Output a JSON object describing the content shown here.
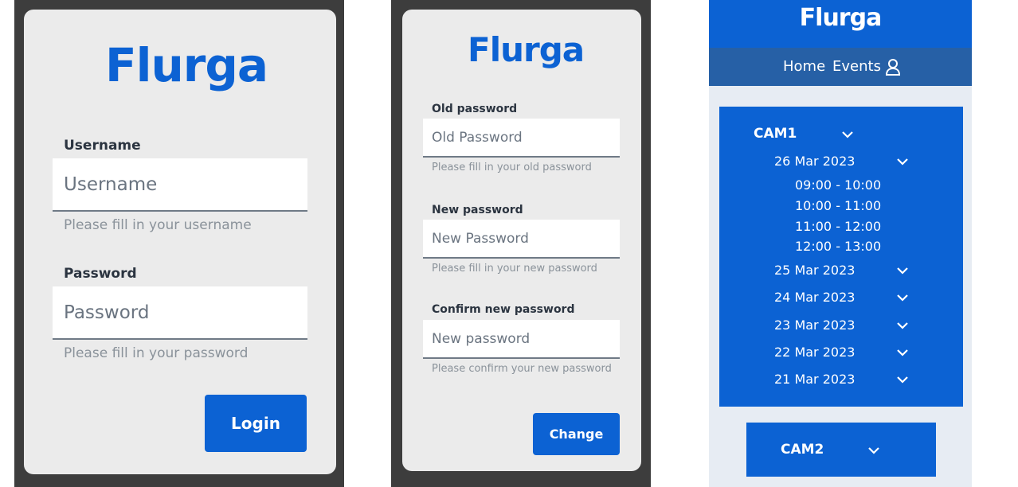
{
  "login": {
    "logo": "Flurga",
    "username_label": "Username",
    "username_placeholder": "Username",
    "username_hint": "Please fill in your username",
    "password_label": "Password",
    "password_placeholder": "Password",
    "password_hint": "Please fill in your password",
    "login_button": "Login"
  },
  "change_password": {
    "logo": "Flurga",
    "old_label": "Old password",
    "old_placeholder": "Old Password",
    "old_hint": "Please fill in your old password",
    "new_label": "New password",
    "new_placeholder": "New Password",
    "new_hint": "Please fill in your new password",
    "confirm_label": "Confirm new password",
    "confirm_placeholder": "New password",
    "confirm_hint": "Please confirm your new password",
    "change_button": "Change"
  },
  "events": {
    "title": "Flurga",
    "nav": {
      "home": "Home",
      "events": "Events",
      "user_icon": "user-icon"
    },
    "cam1": {
      "name": "CAM1",
      "dates": [
        {
          "label": "26 Mar 2023",
          "slots": [
            "09:00 - 10:00",
            "10:00 - 11:00",
            "11:00 - 12:00",
            "12:00 - 13:00"
          ]
        },
        {
          "label": "25 Mar 2023"
        },
        {
          "label": "24 Mar 2023"
        },
        {
          "label": "23 Mar 2023"
        },
        {
          "label": "22 Mar 2023"
        },
        {
          "label": "21 Mar 2023"
        }
      ]
    },
    "cam2": {
      "name": "CAM2"
    }
  },
  "colors": {
    "brand_blue": "#0c62d3",
    "nav_blue": "#2660a6",
    "card_gray": "#ebebeb",
    "frame_dark": "#3d3d3d"
  }
}
